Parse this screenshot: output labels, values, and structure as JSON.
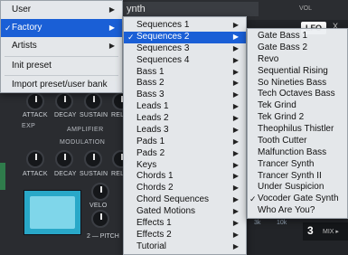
{
  "synth": {
    "patch_name": "ynth",
    "vol_label": "VOL",
    "lfo_label": "LFO",
    "x_label": "X",
    "amplifier_label": "AMPLIFIER",
    "modulation_label": "MODULATION",
    "exp_label": "EXP",
    "knob_labels_row1": [
      "ATTACK",
      "DECAY",
      "SUSTAIN",
      "REL"
    ],
    "knob_labels_row2": [
      "ATTACK",
      "DECAY",
      "SUSTAIN",
      "REL"
    ],
    "velo_label": "VELO",
    "pitch_label": "2 — PITCH",
    "page_number": "3",
    "mix_label": "MIX ▸",
    "freq_labels": [
      "3k",
      "10k"
    ]
  },
  "menu1": {
    "items": [
      {
        "label": "User",
        "arrow": "▶"
      },
      {
        "label": "Factory",
        "arrow": "▶",
        "check": "✓",
        "selected": true
      },
      {
        "label": "Artists",
        "arrow": "▶"
      },
      {
        "label": "Init preset"
      },
      {
        "label": "Import preset/user bank"
      }
    ]
  },
  "menu2": {
    "items": [
      "Sequences 1",
      "Sequences 2",
      "Sequences 3",
      "Sequences 4",
      "Bass 1",
      "Bass 2",
      "Bass 3",
      "Leads 1",
      "Leads 2",
      "Leads 3",
      "Pads 1",
      "Pads 2",
      "Keys",
      "Chords 1",
      "Chords 2",
      "Chord Sequences",
      "Gated Motions",
      "Effects 1",
      "Effects 2",
      "Tutorial"
    ],
    "selected_index": 1,
    "selected_check": "✓",
    "arrow": "▶"
  },
  "menu3": {
    "items": [
      "Gate Bass 1",
      "Gate Bass 2",
      "Revo",
      "Sequential Rising",
      "So Nineties Bass",
      "Tech Octaves Bass",
      "Tek Grind",
      "Tek Grind 2",
      "Theophilus Thistler",
      "Tooth Cutter",
      "Malfunction Bass",
      "Trancer Synth",
      "Trancer Synth II",
      "Under Suspicion",
      "Vocoder Gate Synth",
      "Who Are You?"
    ],
    "checked_index": 14,
    "check": "✓"
  },
  "colors": {
    "highlight": "#1a5fd6",
    "menu_bg": "#eceff2",
    "screen": "#29a8c8"
  }
}
